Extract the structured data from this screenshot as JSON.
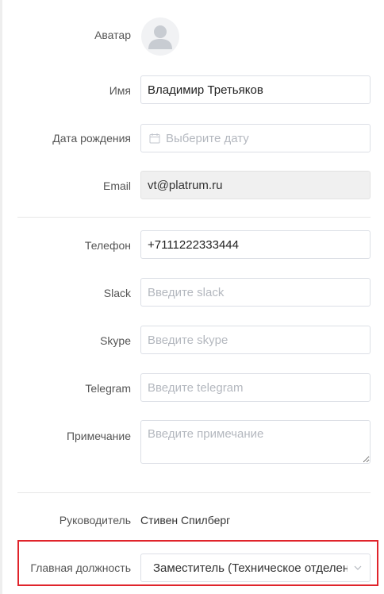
{
  "profile": {
    "avatar_label": "Аватар",
    "name_label": "Имя",
    "name_value": "Владимир Третьяков",
    "birthdate_label": "Дата рождения",
    "birthdate_placeholder": "Выберите дату",
    "email_label": "Email",
    "email_value": "vt@platrum.ru"
  },
  "contacts": {
    "phone_label": "Телефон",
    "phone_value": "+7111222333444",
    "slack_label": "Slack",
    "slack_placeholder": "Введите slack",
    "skype_label": "Skype",
    "skype_placeholder": "Введите skype",
    "telegram_label": "Telegram",
    "telegram_placeholder": "Введите telegram",
    "note_label": "Примечание",
    "note_placeholder": "Введите примечание"
  },
  "organization": {
    "manager_label": "Руководитель",
    "manager_value": "Стивен Спилберг",
    "position_label": "Главная должность",
    "position_value": "Заместитель (Техническое отделение)"
  },
  "colors": {
    "highlight": "#e0242b",
    "placeholder": "#b4b8bf",
    "border": "#dcdfe6"
  }
}
